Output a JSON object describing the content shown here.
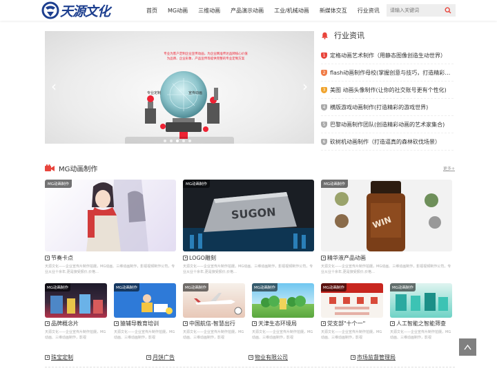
{
  "brand": {
    "logo_text": "天源文化"
  },
  "nav": {
    "items": [
      "首页",
      "MG动画",
      "三维动画",
      "产品演示动画",
      "工业/机械动画",
      "新媒体交互",
      "行业资讯"
    ]
  },
  "search": {
    "placeholder": "请输入关键词"
  },
  "banner": {
    "red_line_1": "专业为客户定制企业宣传动画，为企业精准传达品牌核心价值",
    "red_line_2": "为品牌、企业形象、产品宣传等提供完整的专业定制方案",
    "tag_left": "专业定制",
    "tag_right": "宣传动画",
    "slides_total": 5,
    "slide_active": 3
  },
  "news": {
    "title": "行业资讯",
    "items": [
      {
        "num": "1",
        "text": "定格动画艺术制作（用静态图像创造生动世界）",
        "color": "#e8453c"
      },
      {
        "num": "2",
        "text": "flash动画制作母校(掌握创意与技巧，打造精彩动画作品)",
        "color": "#f07c47"
      },
      {
        "num": "3",
        "text": "美图 动画头像制作(让你的社交账号更有个性化)",
        "color": "#f0a32c"
      },
      {
        "num": "4",
        "text": "横版游戏动画制作(打造精彩的游戏世界)",
        "color": "#aaaaaa"
      },
      {
        "num": "5",
        "text": "巴黎动画制作团队(创造精彩动画的艺术家集合)",
        "color": "#aaaaaa"
      },
      {
        "num": "6",
        "text": "砍树机动画制作（打造逼真的森林砍伐场景）",
        "color": "#aaaaaa"
      }
    ]
  },
  "section": {
    "title": "MG动画制作",
    "more": "更多+"
  },
  "big_cards": [
    {
      "tag": "MG动画制作",
      "title": "节奏卡点",
      "desc": "天源文化——企业宣传片制作拍摄，MG动画、三维动画制作，影视视频制作公司，专业从业十余年,更是接受报价,价格..."
    },
    {
      "tag": "MG动画制作",
      "title": "LOGO雕刻",
      "desc": "天源文化——企业宣传片制作拍摄，MG动画、三维动画制作，影视视频制作公司，专业从业十余年,更是接受报价,价格..."
    },
    {
      "tag": "MG动画制作",
      "title": "精华液产品动画",
      "desc": "天源文化——企业宣传片制作拍摄，MG动画、三维动画制作，影视视频制作公司，专业从业十余年,更是接受报价,价格..."
    }
  ],
  "small_cards": [
    {
      "tag": "MG动画制作",
      "title": "品牌概念片",
      "desc": "天源文化——企业宣传片制作拍摄，MG动画、三维动画制作，影视"
    },
    {
      "tag": "MG动画制作",
      "title": "猿辅导教育培训",
      "desc": "天源文化——企业宣传片制作拍摄，MG动画、三维动画制作，影视"
    },
    {
      "tag": "MG动画制作",
      "title": "中国航信-智慧出行",
      "desc": "天源文化——企业宣传片制作拍摄，MG动画、三维动画制作，影视"
    },
    {
      "tag": "MG动画制作",
      "title": "天津生态环境局",
      "desc": "天源文化——企业宣传片制作拍摄，MG动画、三维动画制作，影视"
    },
    {
      "tag": "MG动画制作",
      "title": "党支部\"十个一\"",
      "desc": "天源文化——企业宣传片制作拍摄，MG动画、三维动画制作，影视"
    },
    {
      "tag": "MG动画制作",
      "title": "人工智能之智能筛查",
      "desc": "天源文化——企业宣传片制作拍摄，MG动画、三维动画制作，影视"
    }
  ],
  "bottom_links": [
    "珠宝定制",
    "月饼广告",
    "物业有限公司",
    "市场监督管理局"
  ],
  "colors": {
    "accent_red": "#e8453c",
    "logo_blue": "#1d3f8f",
    "totop_bg": "#808080"
  }
}
